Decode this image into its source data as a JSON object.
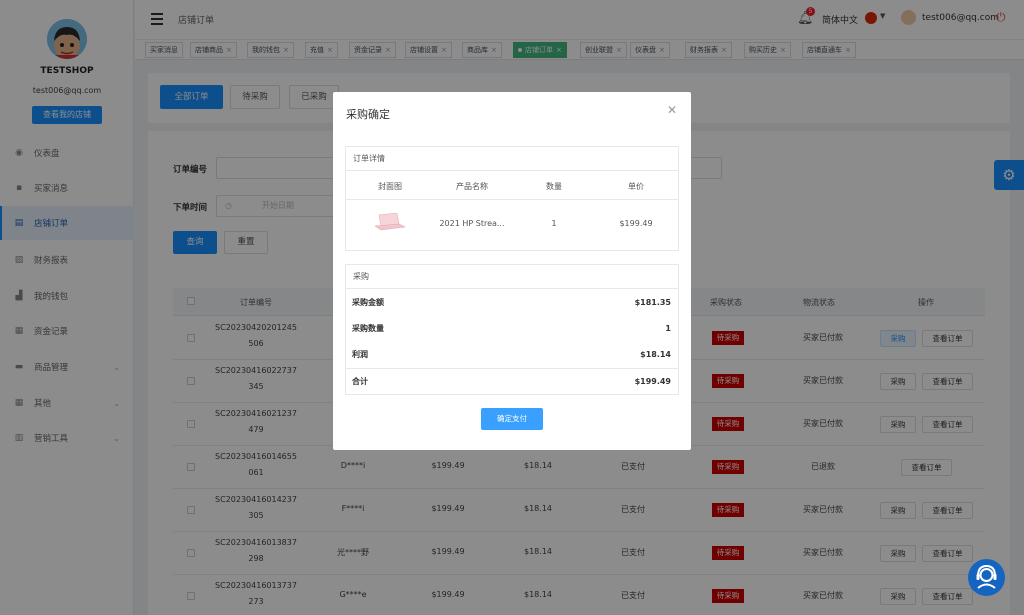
{
  "sidebar": {
    "shop_name": "TESTSHOP",
    "email": "test006@qq.com",
    "view_shop_button": "查看我的店铺",
    "items": [
      {
        "label": "仪表盘",
        "icon": "dashboard-icon",
        "arrow": false
      },
      {
        "label": "买家消息",
        "icon": "chat-icon",
        "arrow": false
      },
      {
        "label": "店铺订单",
        "icon": "clipboard-icon",
        "arrow": false,
        "active": true
      },
      {
        "label": "财务报表",
        "icon": "chart-icon",
        "arrow": false
      },
      {
        "label": "我的钱包",
        "icon": "wallet-icon",
        "arrow": false
      },
      {
        "label": "资金记录",
        "icon": "record-icon",
        "arrow": false
      },
      {
        "label": "商品管理",
        "icon": "box-icon",
        "arrow": true
      },
      {
        "label": "其他",
        "icon": "grid-icon",
        "arrow": true
      },
      {
        "label": "营销工具",
        "icon": "bar-chart-icon",
        "arrow": true
      }
    ]
  },
  "header": {
    "breadcrumb": "店铺订单",
    "notification_count": "5",
    "language": "简体中文",
    "user_email": "test006@qq.com"
  },
  "tags": [
    {
      "label": "买家消息",
      "closable": false
    },
    {
      "label": "店铺商品",
      "closable": true
    },
    {
      "label": "我的钱包",
      "closable": true
    },
    {
      "label": "充值",
      "closable": true
    },
    {
      "label": "资金记录",
      "closable": true
    },
    {
      "label": "店铺设置",
      "closable": true
    },
    {
      "label": "商品库",
      "closable": true
    },
    {
      "label": "店铺订单",
      "closable": true,
      "active": true
    },
    {
      "label": "创业联盟",
      "closable": true
    },
    {
      "label": "仪表盘",
      "closable": true
    },
    {
      "label": "财务报表",
      "closable": true
    },
    {
      "label": "购买历史",
      "closable": true
    },
    {
      "label": "店铺直通车",
      "closable": true
    }
  ],
  "filters": {
    "tabs": [
      "全部订单",
      "待采购",
      "已采购"
    ],
    "order_no_label": "订单编号",
    "order_time_label": "下单时间",
    "start_date_placeholder": "开始日期",
    "query_button": "查询",
    "reset_button": "重置"
  },
  "table": {
    "headers": [
      "订单编号",
      "采购状态",
      "物流状态",
      "操作"
    ],
    "rows": [
      {
        "order_no_1": "SC20230420201245",
        "order_no_2": "506",
        "buyer": "",
        "amount": "",
        "profit": "",
        "pay_status": "",
        "purchase_status": "待采购",
        "logistics": "买家已付款",
        "actions": [
          "采购",
          "查看订单"
        ]
      },
      {
        "order_no_1": "SC20230416022737",
        "order_no_2": "345",
        "buyer": "",
        "amount": "",
        "profit": "",
        "pay_status": "",
        "purchase_status": "待采购",
        "logistics": "买家已付款",
        "actions": [
          "采购",
          "查看订单"
        ]
      },
      {
        "order_no_1": "SC20230416021237",
        "order_no_2": "479",
        "buyer": "",
        "amount": "",
        "profit": "",
        "pay_status": "",
        "purchase_status": "待采购",
        "logistics": "买家已付款",
        "actions": [
          "采购",
          "查看订单"
        ]
      },
      {
        "order_no_1": "SC20230416014655",
        "order_no_2": "061",
        "buyer": "D****i",
        "amount": "$199.49",
        "profit": "$18.14",
        "pay_status": "已支付",
        "purchase_status": "待采购",
        "logistics": "已退款",
        "actions": [
          "查看订单"
        ]
      },
      {
        "order_no_1": "SC20230416014237",
        "order_no_2": "305",
        "buyer": "F****i",
        "amount": "$199.49",
        "profit": "$18.14",
        "pay_status": "已支付",
        "purchase_status": "待采购",
        "logistics": "买家已付款",
        "actions": [
          "采购",
          "查看订单"
        ]
      },
      {
        "order_no_1": "SC20230416013837",
        "order_no_2": "298",
        "buyer": "光****野",
        "amount": "$199.49",
        "profit": "$18.14",
        "pay_status": "已支付",
        "purchase_status": "待采购",
        "logistics": "买家已付款",
        "actions": [
          "采购",
          "查看订单"
        ]
      },
      {
        "order_no_1": "SC20230416013737",
        "order_no_2": "273",
        "buyer": "G****e",
        "amount": "$199.49",
        "profit": "$18.14",
        "pay_status": "已支付",
        "purchase_status": "待采购",
        "logistics": "买家已付款",
        "actions": [
          "采购",
          "查看订单"
        ]
      }
    ]
  },
  "modal": {
    "title": "采购确定",
    "details_title": "订单详情",
    "details_headers": [
      "封面图",
      "产品名称",
      "数量",
      "单价"
    ],
    "product_name": "2021 HP Strea...",
    "quantity": "1",
    "unit_price": "$199.49",
    "purchase_title": "采购",
    "summary": [
      {
        "label": "采购金额",
        "value": "$181.35"
      },
      {
        "label": "采购数量",
        "value": "1"
      },
      {
        "label": "利润",
        "value": "$18.14"
      },
      {
        "label": "合计",
        "value": "$199.49"
      }
    ],
    "confirm_button": "确定支付"
  },
  "colors": {
    "primary": "#1890ff",
    "active_tag": "#42b983",
    "status_red": "#cc0000"
  }
}
